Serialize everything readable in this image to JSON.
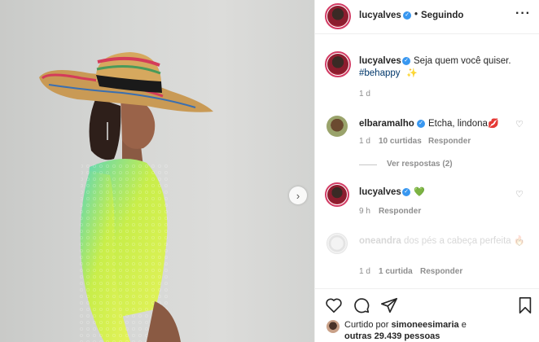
{
  "post": {
    "author": "lucyalves",
    "follow_status": "Seguindo",
    "caption": "Seja quem você quiser.",
    "hashtag": "#behappy",
    "caption_emoji": "✨",
    "caption_time": "1 d"
  },
  "comments": [
    {
      "user": "elbaramalho",
      "text": "Etcha, lindona",
      "emoji": "💋",
      "time": "1 d",
      "likes": "10 curtidas",
      "reply": "Responder",
      "view_replies": "Ver respostas (2)"
    },
    {
      "user": "lucyalves",
      "text": "",
      "emoji": "💚",
      "time": "9 h",
      "reply": "Responder"
    },
    {
      "user": "oneandra",
      "text": "dos pés a cabeça perfeita 🔥",
      "time": "1 d",
      "likes": "1 curtida",
      "reply": "Responder"
    }
  ],
  "likes": {
    "prefix": "Curtido por",
    "user": "simoneesimaria",
    "connector": "e",
    "others": "outras 29.439 pessoas"
  },
  "colors": {
    "accent": "#3897f0",
    "hashtag": "#00376b",
    "ring": "#d33b64"
  },
  "icons": [
    "more-options-icon",
    "heart-icon",
    "comment-icon",
    "share-icon",
    "bookmark-icon",
    "chevron-right-icon",
    "verified-icon"
  ]
}
